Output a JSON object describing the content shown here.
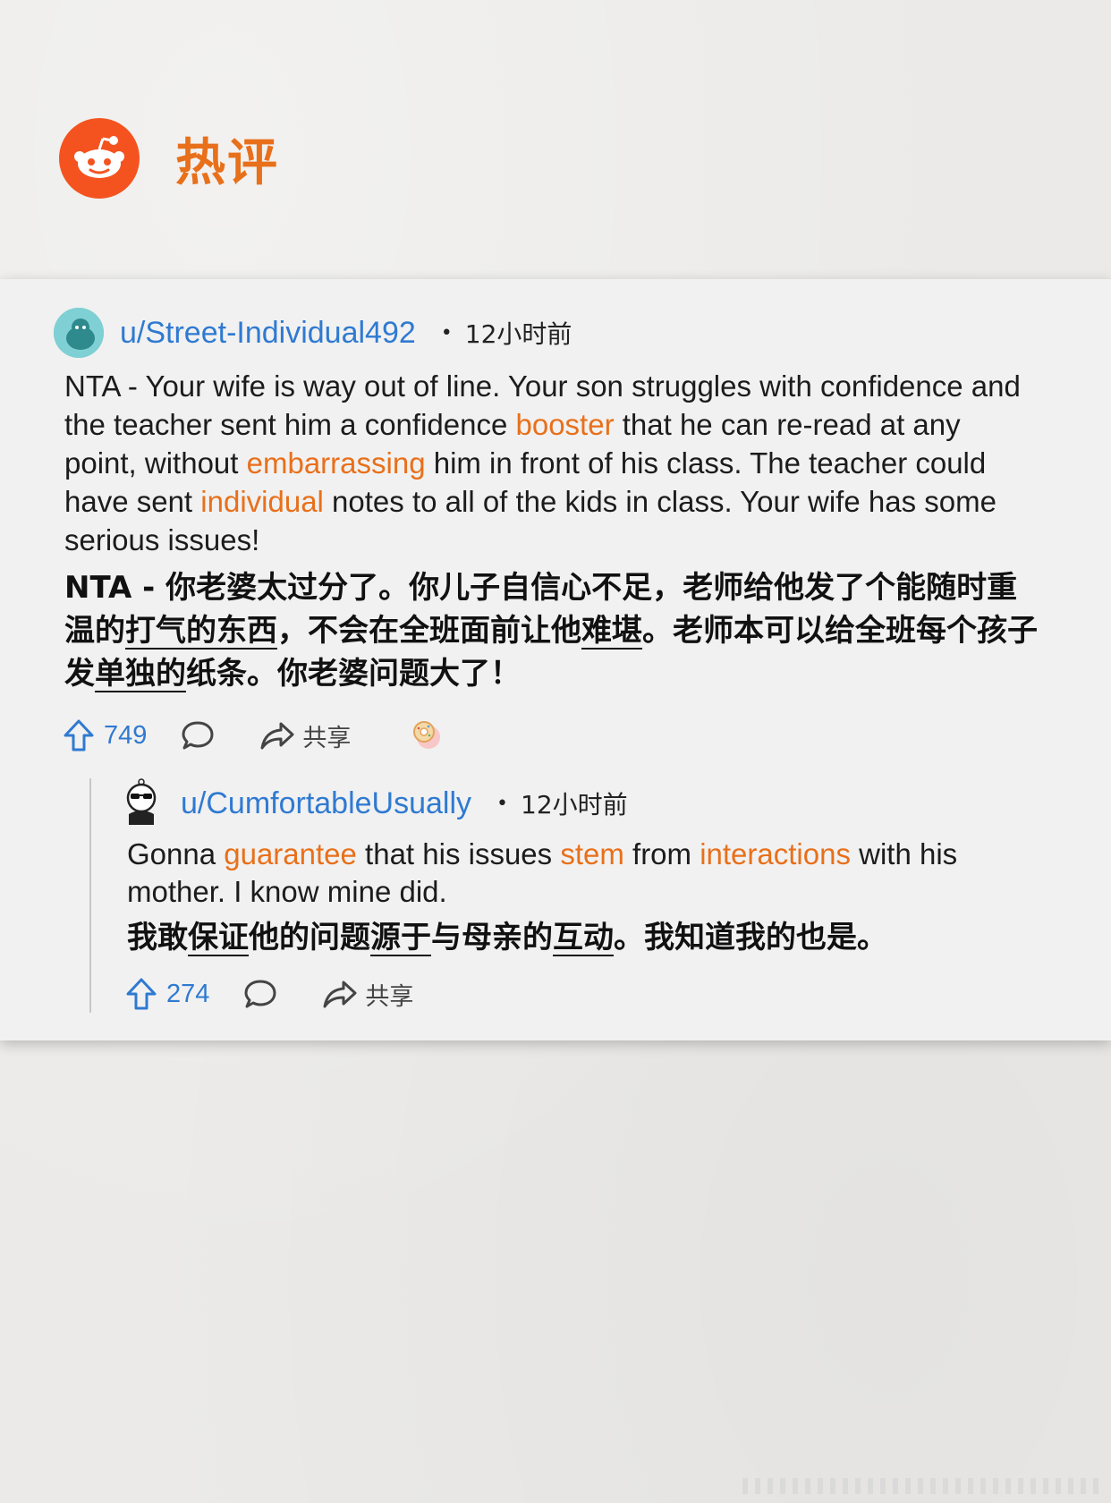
{
  "page_title": "热评",
  "comments": [
    {
      "username": "u/Street-Individual492",
      "dot": "•",
      "timestamp": "12小时前",
      "body_en": [
        {
          "t": "NTA - Your wife is way out of line. Your son struggles with confidence and the teacher sent him a confidence "
        },
        {
          "t": "booster",
          "hl": true
        },
        {
          "t": " that he can re-read at any point, without "
        },
        {
          "t": "embarrassing",
          "hl": true
        },
        {
          "t": " him in front of his class. The teacher could have sent "
        },
        {
          "t": "individual",
          "hl": true
        },
        {
          "t": " notes to all of the kids in class. Your wife has some serious issues!"
        }
      ],
      "body_zh": [
        {
          "t": "NTA - 你老婆太过分了。你儿子自信心不足，老师给他发了个能随时重温的"
        },
        {
          "t": "打气的东西",
          "u": true
        },
        {
          "t": "，不会在全班面前让他"
        },
        {
          "t": "难堪",
          "u": true
        },
        {
          "t": "。老师本可以给全班每个孩子发"
        },
        {
          "t": "单独的",
          "u": true
        },
        {
          "t": "纸条。你老婆问题大了！"
        }
      ],
      "upvotes": "749",
      "share_label": "共享",
      "colors": {
        "username": "#2f7ad1",
        "highlight": "#e8701b"
      }
    },
    {
      "username": "u/CumfortableUsually",
      "dot": "•",
      "timestamp": "12小时前",
      "body_en": [
        {
          "t": "Gonna "
        },
        {
          "t": "guarantee",
          "hl": true
        },
        {
          "t": " that his issues "
        },
        {
          "t": "stem",
          "hl": true
        },
        {
          "t": " from "
        },
        {
          "t": "interactions",
          "hl": true
        },
        {
          "t": " with his mother. I know mine did."
        }
      ],
      "body_zh": [
        {
          "t": "我敢"
        },
        {
          "t": "保证",
          "u": true
        },
        {
          "t": "他的问题"
        },
        {
          "t": "源于",
          "u": true
        },
        {
          "t": "与母亲的"
        },
        {
          "t": "互动",
          "u": true
        },
        {
          "t": "。我知道我的也是。"
        }
      ],
      "upvotes": "274",
      "share_label": "共享"
    }
  ],
  "icons": {
    "logo": "reddit-logo",
    "upvote": "upvote-arrow-icon",
    "reply": "comment-bubble-icon",
    "share": "share-arrow-icon",
    "award": "award-icon"
  }
}
